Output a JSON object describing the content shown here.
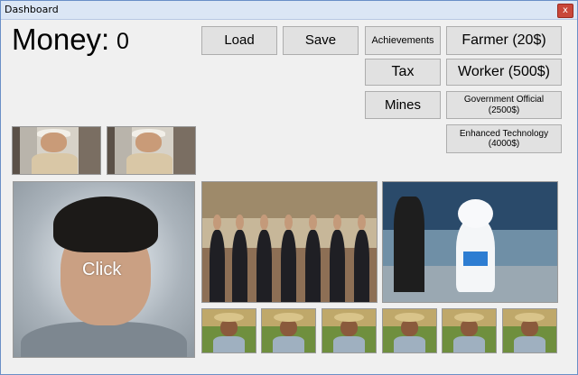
{
  "window": {
    "title": "Dashboard",
    "close_glyph": "x"
  },
  "money": {
    "label": "Money:",
    "value": "0"
  },
  "buttons": {
    "load": "Load",
    "save": "Save",
    "achievements": "Achievements",
    "tax": "Tax",
    "mines": "Mines",
    "farmer": "Farmer (20$)",
    "worker": "Worker (500$)",
    "gov_line1": "Government Official",
    "gov_line2": "(2500$)",
    "tech_line1": "Enhanced Technology",
    "tech_line2": "(4000$)"
  },
  "click_label": "Click",
  "images": {
    "worker_thumbs": 2,
    "farmer_thumbs": 6
  }
}
